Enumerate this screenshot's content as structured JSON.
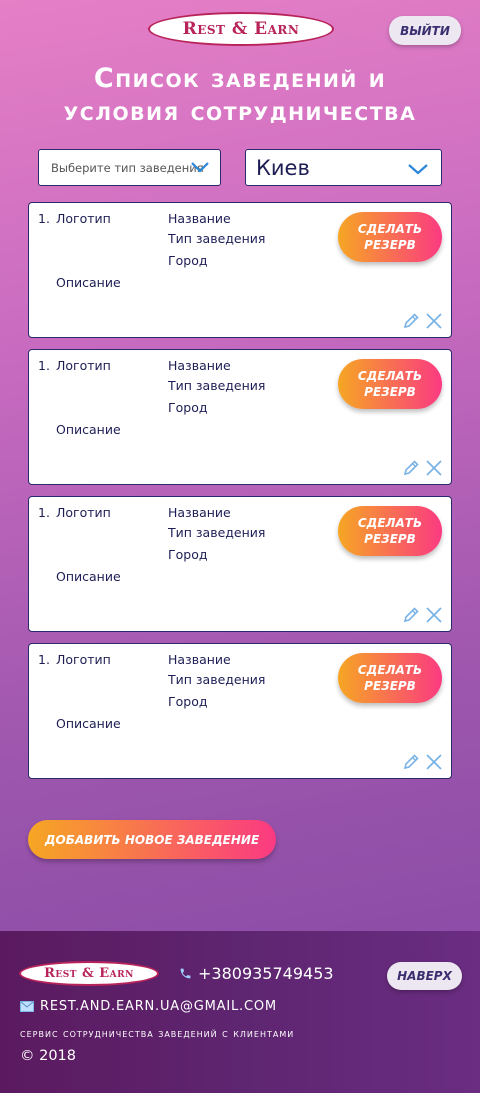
{
  "header": {
    "logo_text": "Rest & Earn",
    "exit_label": "выйти"
  },
  "page_title_line1": "Список заведений и",
  "page_title_line2": "условия сотрудничества",
  "filters": {
    "type_placeholder": "Выберите тип заведения",
    "city_value": "Киев"
  },
  "cards": [
    {
      "number": "1.",
      "logo": "Логотип",
      "name": "Название",
      "type": "Тип заведения",
      "city": "Город",
      "description": "Описание",
      "reserve_label": "Сделать резерв"
    },
    {
      "number": "1.",
      "logo": "Логотип",
      "name": "Название",
      "type": "Тип заведения",
      "city": "Город",
      "description": "Описание",
      "reserve_label": "Сделать резерв"
    },
    {
      "number": "1.",
      "logo": "Логотип",
      "name": "Название",
      "type": "Тип заведения",
      "city": "Город",
      "description": "Описание",
      "reserve_label": "Сделать резерв"
    },
    {
      "number": "1.",
      "logo": "Логотип",
      "name": "Название",
      "type": "Тип заведения",
      "city": "Город",
      "description": "Описание",
      "reserve_label": "Сделать резерв"
    }
  ],
  "add_label": "Добавить новое заведение",
  "footer": {
    "logo_text": "Rest & Earn",
    "phone": "+380935749453",
    "top_label": "наверх",
    "email": "REST.AND.EARN.UA@GMAIL.COM",
    "tagline": "сервис сотрудничества заведений с клиентами",
    "copyright": "© 2018"
  },
  "colors": {
    "accent_start": "#f6a623",
    "accent_end": "#fb3a82",
    "brand": "#b8235a",
    "text_dark": "#1e1e55"
  },
  "icons": {
    "chevron": "chevron-down-icon",
    "edit": "pencil-icon",
    "delete": "close-icon",
    "phone": "phone-icon",
    "email": "envelope-icon"
  }
}
